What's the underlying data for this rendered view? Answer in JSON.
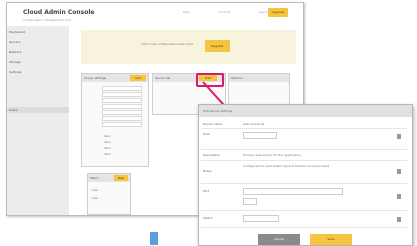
{
  "main_window": {
    "logo": "Cloud Admin Console",
    "subtitle": "configuration management tool",
    "header_links": [
      "Help",
      "Account",
      "Logout"
    ],
    "header_button": "Upgrade",
    "sidebar_items": [
      "Dashboard",
      "Servers",
      "Network",
      "Storage",
      "Settings",
      "Users"
    ],
    "banner": {
      "text": "Add a new configuration item here",
      "button": "Register"
    },
    "panels": [
      {
        "title": "Group settings",
        "tag": "Add"
      },
      {
        "title": "Server list",
        "tag": "Edit"
      },
      {
        "title": "Options",
        "tag": ""
      }
    ],
    "panel_lines": [
      "item",
      "item",
      "item",
      "item"
    ],
    "bottom_panel": {
      "title": "Memo",
      "tag": "New",
      "lines": [
        "note",
        "note"
      ]
    }
  },
  "dialog": {
    "title": "Edit server settings",
    "fields": [
      {
        "label": "Server name",
        "value": "web-server-01"
      },
      {
        "label": "Host",
        "value": ""
      },
      {
        "label": "Description",
        "value": "Primary web server for the application"
      },
      {
        "label": "Notes",
        "value": "Configured for load balancing and failover recovery tasks"
      },
      {
        "label": "Port",
        "value": ""
      },
      {
        "label": "Status",
        "value": ""
      }
    ],
    "buttons": {
      "cancel": "Cancel",
      "ok": "Save"
    }
  },
  "colors": {
    "accent": "#f5c542",
    "highlight": "#e0186c",
    "marker": "#5aa0e0"
  }
}
